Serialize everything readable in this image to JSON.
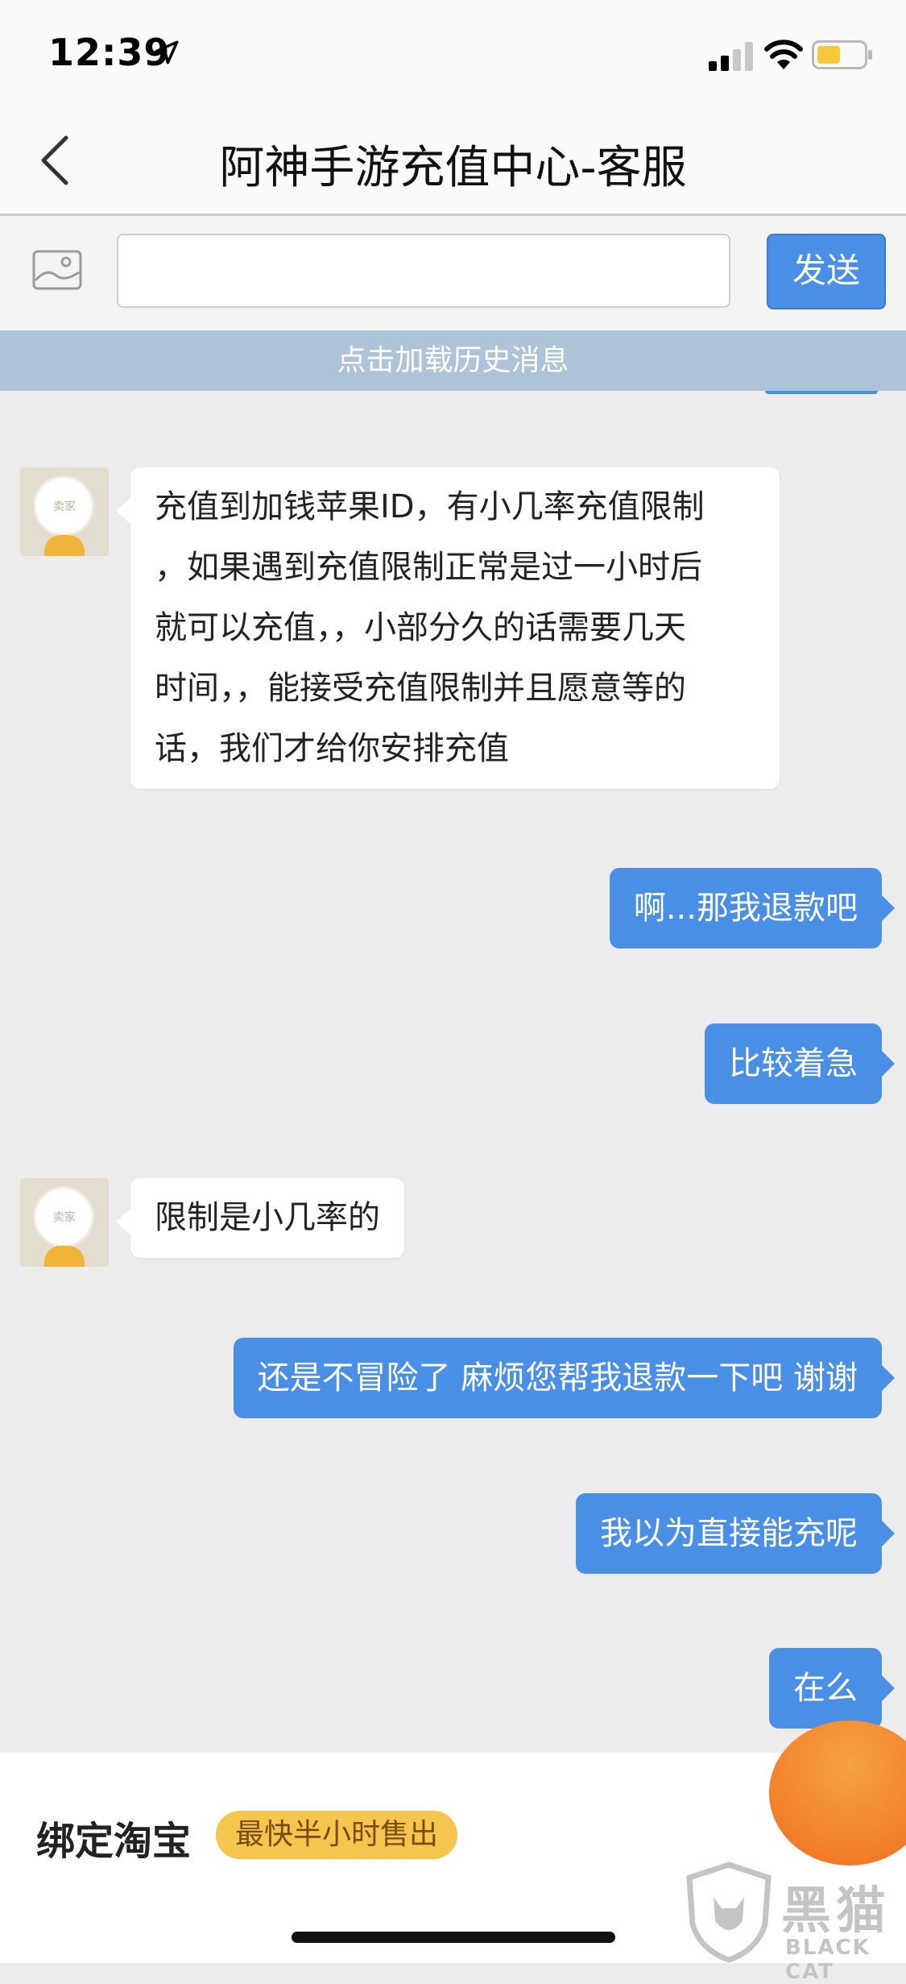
{
  "status_bar": {
    "time": "12:39"
  },
  "header": {
    "title": "阿神手游充值中心-客服"
  },
  "input_bar": {
    "placeholder": "",
    "send_label": "发送"
  },
  "history": {
    "load_label": "点击加载历史消息"
  },
  "messages": [
    {
      "side": "in",
      "avatar_tag": "卖家",
      "lines": [
        "充值到加钱苹果ID，有小几率充值限制",
        "，如果遇到充值限制正常是过一小时后",
        "就可以充值，，小部分久的话需要几天",
        "时间，，能接受充值限制并且愿意等的",
        "话，我们才给你安排充值"
      ]
    },
    {
      "side": "out",
      "text": "啊...那我退款吧"
    },
    {
      "side": "out",
      "text": "比较着急"
    },
    {
      "side": "in",
      "avatar_tag": "卖家",
      "lines": [
        "限制是小几率的"
      ]
    },
    {
      "side": "out",
      "text": "还是不冒险了 麻烦您帮我退款一下吧 谢谢"
    },
    {
      "side": "out",
      "text": "我以为直接能充呢"
    },
    {
      "side": "out",
      "text": "在么"
    }
  ],
  "bottom": {
    "bind_label": "绑定淘宝",
    "sell_badge": "最快半小时售出"
  },
  "watermark": {
    "cn": "黑猫",
    "en": "BLACK CAT"
  },
  "colors": {
    "accent": "#4a8fe6",
    "history_bar": "#adc3d8",
    "badge": "#f5c64e"
  }
}
